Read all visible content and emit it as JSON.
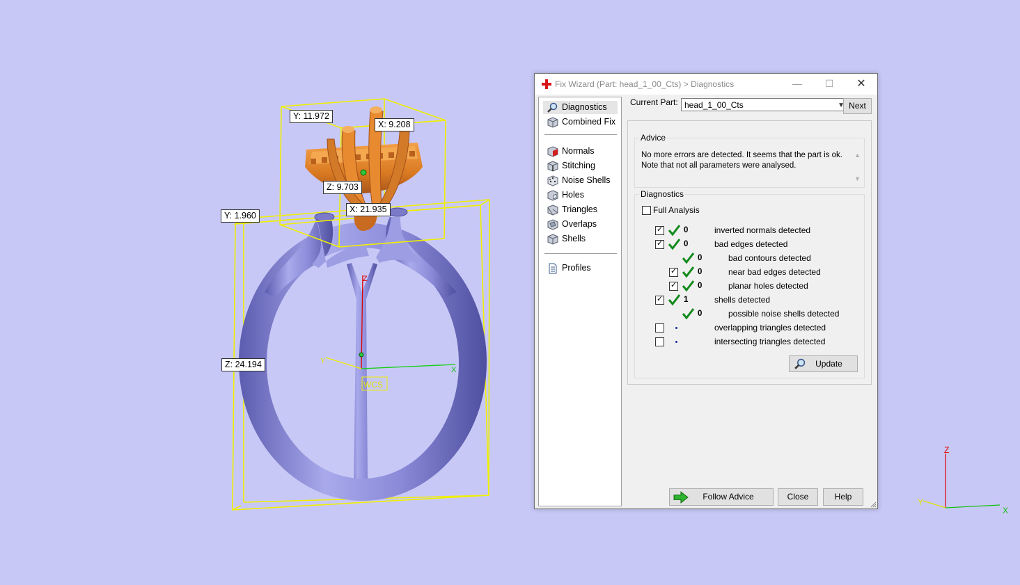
{
  "viewport": {
    "dimensions": {
      "y_head": "Y: 11.972",
      "x_head": "X: 9.208",
      "z_head": "Z: 9.703",
      "x_ring": "X: 21.935",
      "y_ring": "Y: 1.960",
      "z_ring": "Z: 24.194"
    },
    "wcs_label": "WCS",
    "axis_labels": {
      "z": "Z",
      "y": "Y",
      "x": "X"
    },
    "colors": {
      "background": "#c8c8f7",
      "ring": "#8e8ed8",
      "head": "#e08a2e",
      "bbox": "#f0f000"
    }
  },
  "window": {
    "title": "Fix Wizard (Part: head_1_00_Cts) > Diagnostics",
    "controls": {
      "minimize": "—",
      "maximize": "☐",
      "close": "✕"
    },
    "nav": {
      "items": [
        {
          "label": "Diagnostics",
          "icon": "magnifier-icon",
          "selected": true
        },
        {
          "label": "Combined Fix",
          "icon": "cube-icon"
        },
        {
          "label": "Normals",
          "icon": "normals-cube-icon"
        },
        {
          "label": "Stitching",
          "icon": "stitch-cube-icon"
        },
        {
          "label": "Noise Shells",
          "icon": "dice-icon"
        },
        {
          "label": "Holes",
          "icon": "hole-cube-icon"
        },
        {
          "label": "Triangles",
          "icon": "triangle-cube-icon"
        },
        {
          "label": "Overlaps",
          "icon": "overlap-cube-icon"
        },
        {
          "label": "Shells",
          "icon": "shell-cube-icon"
        },
        {
          "label": "Profiles",
          "icon": "document-icon"
        }
      ]
    },
    "current_part_label": "Current Part:",
    "current_part_value": "head_1_00_Cts",
    "next_button": "Next",
    "advice": {
      "title": "Advice",
      "line1": "No more errors are detected. It seems that the part is ok.",
      "line2": "Note that not all parameters were analysed."
    },
    "diagnostics": {
      "title": "Diagnostics",
      "full_analysis": "Full Analysis",
      "rows": [
        {
          "checkbox": true,
          "status": "ok",
          "count": "0",
          "text": "inverted normals detected"
        },
        {
          "checkbox": true,
          "status": "ok",
          "count": "0",
          "text": "bad edges detected"
        },
        {
          "checkbox": null,
          "status": "ok",
          "count": "0",
          "text": "bad contours detected"
        },
        {
          "checkbox": true,
          "status": "ok",
          "count": "0",
          "text": "near bad edges detected"
        },
        {
          "checkbox": true,
          "status": "ok",
          "count": "0",
          "text": "planar holes detected"
        },
        {
          "checkbox": true,
          "status": "ok",
          "count": "1",
          "text": "shells detected"
        },
        {
          "checkbox": null,
          "status": "ok",
          "count": "0",
          "text": "possible noise shells detected"
        },
        {
          "checkbox": false,
          "status": "pending",
          "count": "",
          "text": "overlapping triangles detected"
        },
        {
          "checkbox": false,
          "status": "pending",
          "count": "",
          "text": "intersecting triangles detected"
        }
      ],
      "update_button": "Update"
    },
    "footer": {
      "follow_advice": "Follow Advice",
      "close": "Close",
      "help": "Help"
    }
  },
  "corner_axes": {
    "z": "Z",
    "y": "Y",
    "x": "X"
  }
}
